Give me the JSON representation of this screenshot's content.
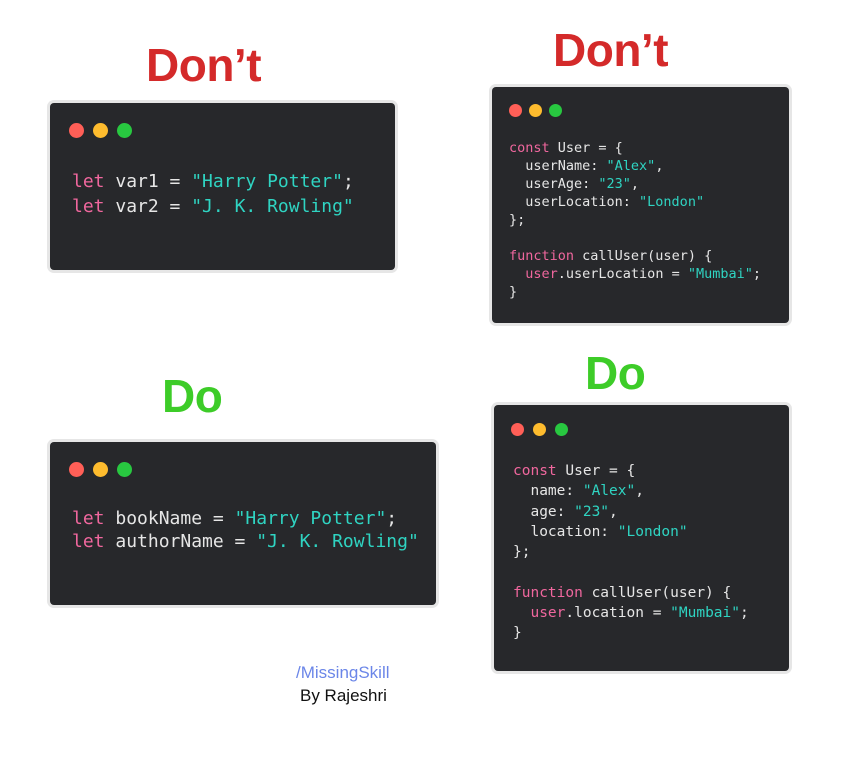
{
  "labels": {
    "dont": "Don’t",
    "do": "Do"
  },
  "colors": {
    "dont": "#d42a2a",
    "do": "#3dcc28",
    "card_background": "#27282b",
    "keyword": "#f0679e",
    "string": "#2fd4c2",
    "plain": "#e6e6e6",
    "dot_red": "#ff5f57",
    "dot_yellow": "#febc2e",
    "dot_green": "#28c840",
    "brand": "#6b86e8"
  },
  "snippets": {
    "dont_vars": [
      [
        {
          "t": "let",
          "c": "kw"
        },
        {
          "t": " var1 = "
        },
        {
          "t": "\"Harry Potter\"",
          "c": "str"
        },
        {
          "t": ";"
        }
      ],
      [
        {
          "t": "let",
          "c": "kw"
        },
        {
          "t": " var2 = "
        },
        {
          "t": "\"J. K. Rowling\"",
          "c": "str"
        }
      ]
    ],
    "dont_object": [
      [
        {
          "t": "const",
          "c": "kw"
        },
        {
          "t": " User = {"
        }
      ],
      [
        {
          "t": "  userName: "
        },
        {
          "t": "\"Alex\"",
          "c": "str"
        },
        {
          "t": ","
        }
      ],
      [
        {
          "t": "  userAge: "
        },
        {
          "t": "\"23\"",
          "c": "str"
        },
        {
          "t": ","
        }
      ],
      [
        {
          "t": "  userLocation: "
        },
        {
          "t": "\"London\"",
          "c": "str"
        }
      ],
      [
        {
          "t": "};"
        }
      ],
      [
        {
          "t": ""
        }
      ],
      [
        {
          "t": "function",
          "c": "kw"
        },
        {
          "t": " callUser(user) {"
        }
      ],
      [
        {
          "t": "  "
        },
        {
          "t": "user",
          "c": "obj"
        },
        {
          "t": ".userLocation = "
        },
        {
          "t": "\"Mumbai\"",
          "c": "str"
        },
        {
          "t": ";"
        }
      ],
      [
        {
          "t": "}"
        }
      ]
    ],
    "do_vars": [
      [
        {
          "t": "let",
          "c": "kw"
        },
        {
          "t": " bookName = "
        },
        {
          "t": "\"Harry Potter\"",
          "c": "str"
        },
        {
          "t": ";"
        }
      ],
      [
        {
          "t": "let",
          "c": "kw"
        },
        {
          "t": " authorName = "
        },
        {
          "t": "\"J. K. Rowling\"",
          "c": "str"
        }
      ]
    ],
    "do_object": [
      [
        {
          "t": "const",
          "c": "kw"
        },
        {
          "t": " User = {"
        }
      ],
      [
        {
          "t": "  name: "
        },
        {
          "t": "\"Alex\"",
          "c": "str"
        },
        {
          "t": ","
        }
      ],
      [
        {
          "t": "  age: "
        },
        {
          "t": "\"23\"",
          "c": "str"
        },
        {
          "t": ","
        }
      ],
      [
        {
          "t": "  location: "
        },
        {
          "t": "\"London\"",
          "c": "str"
        }
      ],
      [
        {
          "t": "};"
        }
      ],
      [
        {
          "t": ""
        }
      ],
      [
        {
          "t": "function",
          "c": "kw"
        },
        {
          "t": " callUser(user) {"
        }
      ],
      [
        {
          "t": "  "
        },
        {
          "t": "user",
          "c": "obj"
        },
        {
          "t": ".location = "
        },
        {
          "t": "\"Mumbai\"",
          "c": "str"
        },
        {
          "t": ";"
        }
      ],
      [
        {
          "t": "}"
        }
      ]
    ]
  },
  "footer": {
    "brand": "/MissingSkill",
    "byline": "By Rajeshri"
  }
}
